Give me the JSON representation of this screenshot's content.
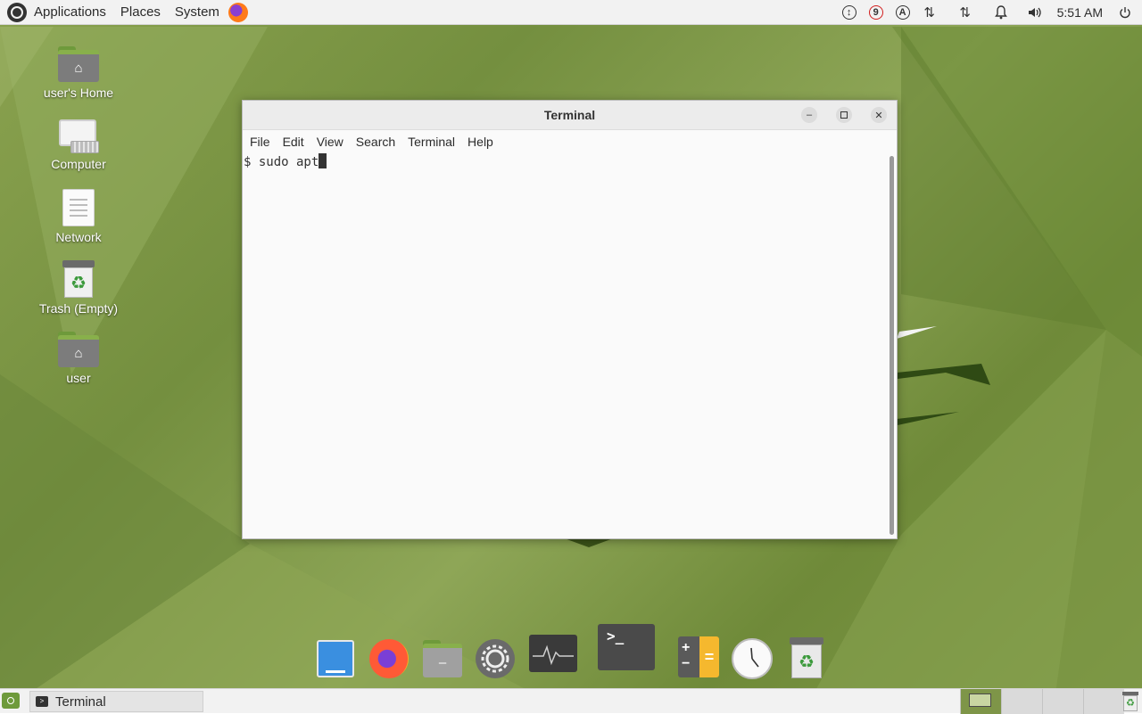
{
  "top_panel": {
    "menus": [
      "Applications",
      "Places",
      "System"
    ],
    "tray": {
      "badge_count": "9",
      "indicator_letter": "A",
      "clock": "5:51 AM"
    }
  },
  "desktop_icons": [
    {
      "label": "user's Home",
      "icon": "home-folder-icon"
    },
    {
      "label": "Computer",
      "icon": "computer-icon"
    },
    {
      "label": "Network",
      "icon": "network-icon"
    },
    {
      "label": "Trash (Empty)",
      "icon": "trash-icon"
    },
    {
      "label": "user",
      "icon": "home-folder-icon"
    }
  ],
  "window": {
    "title": "Terminal",
    "menu": [
      "File",
      "Edit",
      "View",
      "Search",
      "Terminal",
      "Help"
    ],
    "content": "$ sudo apt"
  },
  "dock": [
    "window-icon",
    "firefox-icon",
    "files-icon",
    "settings-icon",
    "system-monitor-icon",
    "terminal-icon",
    "calculator-icon",
    "clock-icon",
    "trash-icon"
  ],
  "bottom_panel": {
    "task_label": "Terminal"
  }
}
